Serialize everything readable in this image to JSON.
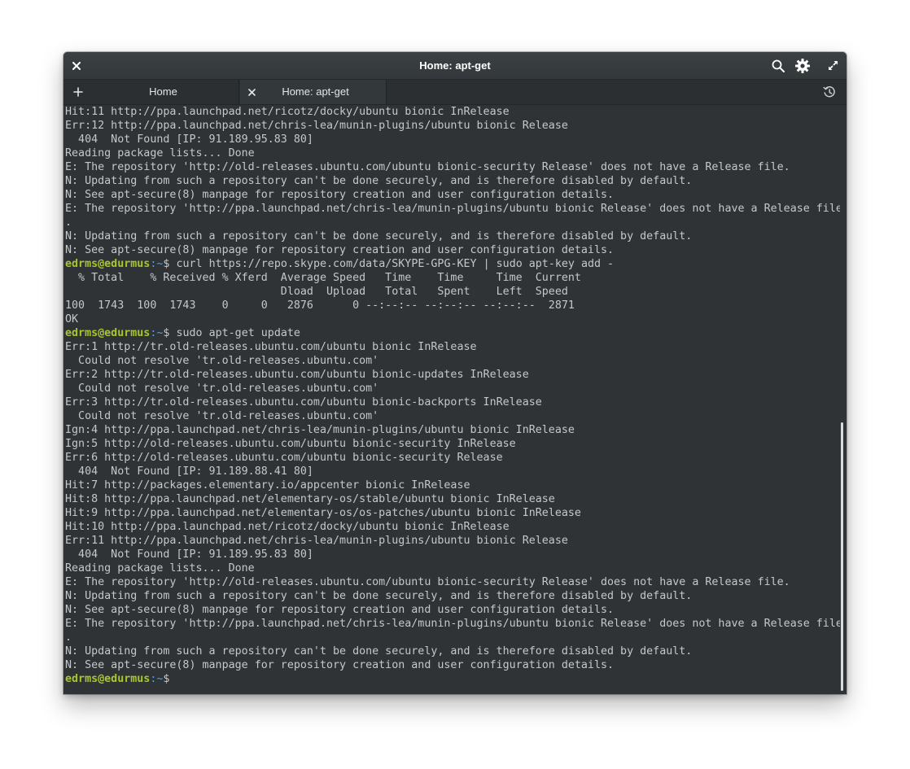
{
  "window": {
    "title": "Home: apt-get"
  },
  "tabs": [
    {
      "label": "Home"
    },
    {
      "label": "Home: apt-get"
    }
  ],
  "terminal": {
    "lines": [
      {
        "text": "Hit:11 http://ppa.launchpad.net/ricotz/docky/ubuntu bionic InRelease"
      },
      {
        "text": "Err:12 http://ppa.launchpad.net/chris-lea/munin-plugins/ubuntu bionic Release"
      },
      {
        "text": "  404  Not Found [IP: 91.189.95.83 80]"
      },
      {
        "text": "Reading package lists... Done"
      },
      {
        "text": "E: The repository 'http://old-releases.ubuntu.com/ubuntu bionic-security Release' does not have a Release file."
      },
      {
        "text": "N: Updating from such a repository can't be done securely, and is therefore disabled by default."
      },
      {
        "text": "N: See apt-secure(8) manpage for repository creation and user configuration details."
      },
      {
        "text": "E: The repository 'http://ppa.launchpad.net/chris-lea/munin-plugins/ubuntu bionic Release' does not have a Release file"
      },
      {
        "text": "."
      },
      {
        "text": "N: Updating from such a repository can't be done securely, and is therefore disabled by default."
      },
      {
        "text": "N: See apt-secure(8) manpage for repository creation and user configuration details."
      },
      {
        "prompt": true,
        "user": "edrms@edurmus",
        "path": ":~",
        "sym": "$ ",
        "cmd": "curl https://repo.skype.com/data/SKYPE-GPG-KEY | sudo apt-key add -"
      },
      {
        "text": "  % Total    % Received % Xferd  Average Speed   Time    Time     Time  Current"
      },
      {
        "text": "                                 Dload  Upload   Total   Spent    Left  Speed"
      },
      {
        "text": "100  1743  100  1743    0     0   2876      0 --:--:-- --:--:-- --:--:--  2871"
      },
      {
        "text": "OK"
      },
      {
        "prompt": true,
        "user": "edrms@edurmus",
        "path": ":~",
        "sym": "$ ",
        "cmd": "sudo apt-get update"
      },
      {
        "text": "Err:1 http://tr.old-releases.ubuntu.com/ubuntu bionic InRelease"
      },
      {
        "text": "  Could not resolve 'tr.old-releases.ubuntu.com'"
      },
      {
        "text": "Err:2 http://tr.old-releases.ubuntu.com/ubuntu bionic-updates InRelease"
      },
      {
        "text": "  Could not resolve 'tr.old-releases.ubuntu.com'"
      },
      {
        "text": "Err:3 http://tr.old-releases.ubuntu.com/ubuntu bionic-backports InRelease"
      },
      {
        "text": "  Could not resolve 'tr.old-releases.ubuntu.com'"
      },
      {
        "text": "Ign:4 http://ppa.launchpad.net/chris-lea/munin-plugins/ubuntu bionic InRelease"
      },
      {
        "text": "Ign:5 http://old-releases.ubuntu.com/ubuntu bionic-security InRelease"
      },
      {
        "text": "Err:6 http://old-releases.ubuntu.com/ubuntu bionic-security Release"
      },
      {
        "text": "  404  Not Found [IP: 91.189.88.41 80]"
      },
      {
        "text": "Hit:7 http://packages.elementary.io/appcenter bionic InRelease"
      },
      {
        "text": "Hit:8 http://ppa.launchpad.net/elementary-os/stable/ubuntu bionic InRelease"
      },
      {
        "text": "Hit:9 http://ppa.launchpad.net/elementary-os/os-patches/ubuntu bionic InRelease"
      },
      {
        "text": "Hit:10 http://ppa.launchpad.net/ricotz/docky/ubuntu bionic InRelease"
      },
      {
        "text": "Err:11 http://ppa.launchpad.net/chris-lea/munin-plugins/ubuntu bionic Release"
      },
      {
        "text": "  404  Not Found [IP: 91.189.95.83 80]"
      },
      {
        "text": "Reading package lists... Done"
      },
      {
        "text": "E: The repository 'http://old-releases.ubuntu.com/ubuntu bionic-security Release' does not have a Release file."
      },
      {
        "text": "N: Updating from such a repository can't be done securely, and is therefore disabled by default."
      },
      {
        "text": "N: See apt-secure(8) manpage for repository creation and user configuration details."
      },
      {
        "text": "E: The repository 'http://ppa.launchpad.net/chris-lea/munin-plugins/ubuntu bionic Release' does not have a Release file"
      },
      {
        "text": "."
      },
      {
        "text": "N: Updating from such a repository can't be done securely, and is therefore disabled by default."
      },
      {
        "text": "N: See apt-secure(8) manpage for repository creation and user configuration details."
      },
      {
        "prompt": true,
        "user": "edrms@edurmus",
        "path": ":~",
        "sym": "$ ",
        "cmd": ""
      }
    ]
  },
  "colors": {
    "background": "#2f3336",
    "text": "#c5c8c9",
    "prompt_user": "#a7c630",
    "prompt_path": "#4aa3e0"
  },
  "icons": {
    "close": "close-icon",
    "search": "search-icon",
    "settings": "gear-icon",
    "maximize": "maximize-icon",
    "new_tab": "plus-icon",
    "tab_close": "close-icon",
    "history": "history-icon"
  }
}
